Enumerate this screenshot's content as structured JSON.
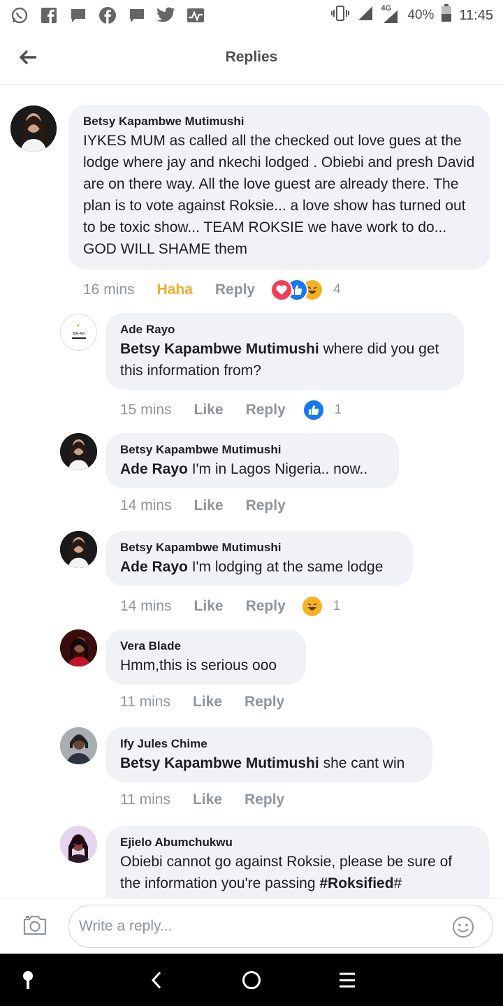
{
  "status_bar": {
    "network": "4G",
    "battery": "40%",
    "time": "11:45",
    "app_icons": [
      "whatsapp-icon",
      "facebook-icon",
      "message-icon",
      "facebook-icon",
      "message-icon",
      "twitter-icon",
      "activity-icon"
    ]
  },
  "header": {
    "title": "Replies",
    "back_icon": "arrow-left-icon"
  },
  "comments": [
    {
      "author": "Betsy Kapambwe Mutimushi",
      "mention": "",
      "text": "IYKES MUM as called all the checked out love gues at the lodge where jay and nkechi lodged . Obiebi and presh David are on there way. All the love guest are already there. The plan is to vote against Roksie... a love show has turned out to be toxic show... TEAM ROKSIE we have work to do... GOD WILL SHAME them",
      "time": "16 mins",
      "reaction_label": "Haha",
      "reply_label": "Reply",
      "reactions": [
        "love",
        "like",
        "haha"
      ],
      "reaction_count": "4"
    },
    {
      "author": "Ade Rayo",
      "mention": "Betsy Kapambwe Mutimushi",
      "text": " where did you get this information from?",
      "time": "15 mins",
      "like_label": "Like",
      "reply_label": "Reply",
      "reactions": [
        "like"
      ],
      "reaction_count": "1",
      "avatar_label": "BA-AD"
    },
    {
      "author": "Betsy Kapambwe Mutimushi",
      "mention": "Ade Rayo",
      "text": " I'm in Lagos Nigeria.. now..",
      "time": "14 mins",
      "like_label": "Like",
      "reply_label": "Reply"
    },
    {
      "author": "Betsy Kapambwe Mutimushi",
      "mention": "Ade Rayo",
      "text": " I'm lodging at the same lodge",
      "time": "14 mins",
      "like_label": "Like",
      "reply_label": "Reply",
      "reactions": [
        "haha"
      ],
      "reaction_count": "1"
    },
    {
      "author": "Vera Blade",
      "mention": "",
      "text": "Hmm,this is serious ooo",
      "time": "11 mins",
      "like_label": "Like",
      "reply_label": "Reply"
    },
    {
      "author": "Ify Jules Chime",
      "mention": "Betsy Kapambwe Mutimushi",
      "text": " she cant win",
      "time": "11 mins",
      "like_label": "Like",
      "reply_label": "Reply"
    },
    {
      "author": "Ejielo Abumchukwu",
      "mention": "",
      "text": "Obiebi cannot go against Roksie, please be sure of the information you're passing ",
      "hashtag": "#Roksified",
      "hashtag_suffix": "#"
    }
  ],
  "composer": {
    "placeholder": "Write a reply...",
    "camera_icon": "camera-icon",
    "emoji_icon": "emoji-icon"
  },
  "nav": [
    "assistant-icon",
    "back-icon",
    "home-icon",
    "menu-icon"
  ],
  "colors": {
    "bubble": "#f0f2f5",
    "meta": "#90949c",
    "haha_active": "#f0ad30",
    "like_blue": "#1877f2",
    "love_red": "#f33e58",
    "haha_yellow": "#f7b125"
  }
}
